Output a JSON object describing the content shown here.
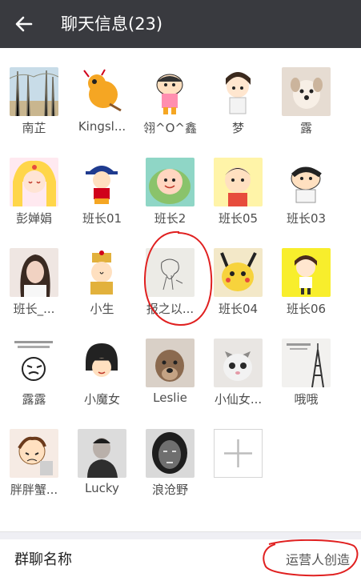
{
  "header": {
    "title": "聊天信息(23)"
  },
  "members": [
    {
      "name": "南芷",
      "avatar": "photo-trees"
    },
    {
      "name": "Kingsl...",
      "avatar": "cartoon-dragon"
    },
    {
      "name": "翎^O^鑫",
      "avatar": "cartoon-shinchan-pink"
    },
    {
      "name": "梦",
      "avatar": "cartoon-girl"
    },
    {
      "name": "露",
      "avatar": "photo-dog"
    },
    {
      "name": "彭婵娟",
      "avatar": "cartoon-sailormoon"
    },
    {
      "name": "班长01",
      "avatar": "cartoon-boy-cap"
    },
    {
      "name": "班长2",
      "avatar": "cartoon-green"
    },
    {
      "name": "班长05",
      "avatar": "cartoon-boy"
    },
    {
      "name": "班长03",
      "avatar": "cartoon-shinchan"
    },
    {
      "name": "班长_...",
      "avatar": "photo-woman"
    },
    {
      "name": "小生",
      "avatar": "cartoon-emperor"
    },
    {
      "name": "报之以...",
      "avatar": "sketch-figure"
    },
    {
      "name": "班长04",
      "avatar": "cartoon-pikachu"
    },
    {
      "name": "班长06",
      "avatar": "cartoon-girl-yellow"
    },
    {
      "name": "露露",
      "avatar": "meme-face"
    },
    {
      "name": "小魔女",
      "avatar": "cartoon-maruko"
    },
    {
      "name": "Leslie",
      "avatar": "photo-pitbull"
    },
    {
      "name": "小仙女...",
      "avatar": "photo-cat"
    },
    {
      "name": "哦哦",
      "avatar": "photo-eiffel"
    },
    {
      "name": "胖胖蟹...",
      "avatar": "cartoon-crying"
    },
    {
      "name": "Lucky",
      "avatar": "photo-man"
    },
    {
      "name": "浪沧野",
      "avatar": "sketch-face"
    }
  ],
  "add_button": {
    "icon": "plus-icon"
  },
  "group_name_row": {
    "label": "群聊名称",
    "value": "运营人创造"
  },
  "colors": {
    "header": "#393a3f",
    "accent_annotation": "#e02020"
  }
}
